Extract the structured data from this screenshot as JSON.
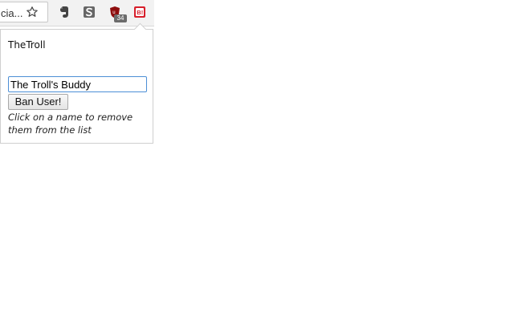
{
  "toolbar": {
    "omnibox_text": "cia...",
    "star_icon": "star-icon",
    "extension_icons": [
      {
        "name": "evernote-icon"
      },
      {
        "name": "s-icon"
      },
      {
        "name": "ublock-origin-icon",
        "badge": "34"
      },
      {
        "name": "banned-user-extension-icon"
      }
    ]
  },
  "popup": {
    "banned_users": [
      "TheTroll"
    ],
    "input_value": "The Troll's Buddy",
    "ban_button_label": "Ban User!",
    "help_text": "Click on a name to remove them from the list"
  },
  "colors": {
    "toolbar_background": "#f2f2f2",
    "input_border": "#4c8fd6",
    "extension_red": "#d71f2b",
    "badge_gray": "#6b6b6b"
  }
}
